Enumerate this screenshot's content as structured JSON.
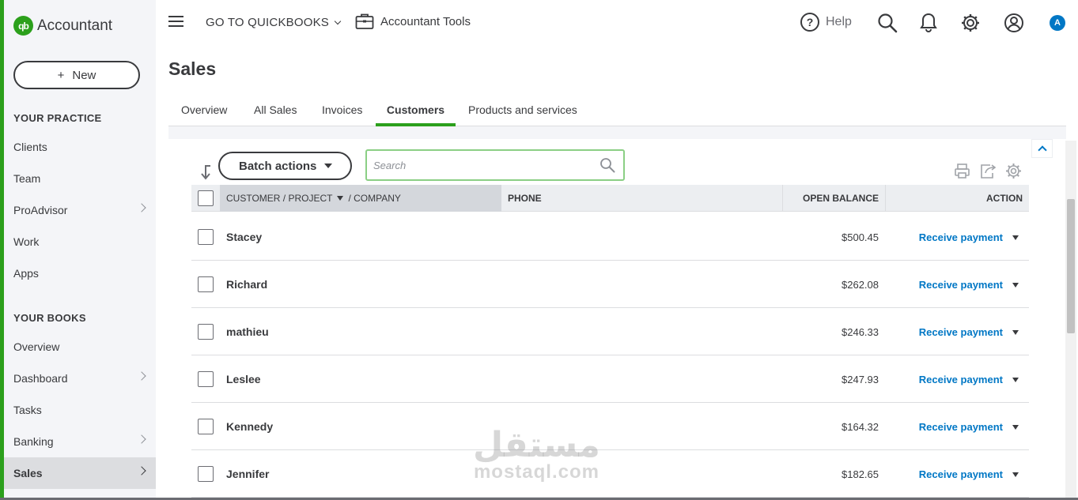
{
  "app": {
    "brand": "Accountant",
    "logo_text": "qb",
    "accent_color": "#2ca01c",
    "link_color": "#0077c5"
  },
  "sidebar": {
    "new_label": "New",
    "new_icon": "plus-icon",
    "practice_heading": "YOUR PRACTICE",
    "practice_items": [
      {
        "label": "Clients",
        "has_submenu": false
      },
      {
        "label": "Team",
        "has_submenu": false
      },
      {
        "label": "ProAdvisor",
        "has_submenu": true
      },
      {
        "label": "Work",
        "has_submenu": false
      },
      {
        "label": "Apps",
        "has_submenu": false
      }
    ],
    "books_heading": "YOUR BOOKS",
    "books_items": [
      {
        "label": "Overview",
        "has_submenu": false
      },
      {
        "label": "Dashboard",
        "has_submenu": true
      },
      {
        "label": "Tasks",
        "has_submenu": false
      },
      {
        "label": "Banking",
        "has_submenu": true
      },
      {
        "label": "Sales",
        "has_submenu": true,
        "active": true
      }
    ]
  },
  "topbar": {
    "goto_label": "GO TO QUICKBOOKS",
    "accountant_tools_label": "Accountant Tools",
    "help_label": "Help",
    "avatar_initial": "A"
  },
  "page": {
    "title": "Sales",
    "tabs": [
      {
        "label": "Overview",
        "active": false
      },
      {
        "label": "All Sales",
        "active": false
      },
      {
        "label": "Invoices",
        "active": false
      },
      {
        "label": "Customers",
        "active": true
      },
      {
        "label": "Products and services",
        "active": false
      }
    ]
  },
  "toolbar": {
    "batch_actions_label": "Batch actions",
    "search_placeholder": "Search",
    "search_value": ""
  },
  "table": {
    "columns": {
      "customer": "CUSTOMER / PROJECT",
      "company": "/ COMPANY",
      "phone": "PHONE",
      "open_balance": "OPEN BALANCE",
      "action": "ACTION"
    },
    "rows": [
      {
        "name": "Stacey",
        "phone": "",
        "balance": "$500.45",
        "action": "Receive payment"
      },
      {
        "name": "Richard",
        "phone": "",
        "balance": "$262.08",
        "action": "Receive payment"
      },
      {
        "name": "mathieu",
        "phone": "",
        "balance": "$246.33",
        "action": "Receive payment"
      },
      {
        "name": "Leslee",
        "phone": "",
        "balance": "$247.93",
        "action": "Receive payment"
      },
      {
        "name": "Kennedy",
        "phone": "",
        "balance": "$164.32",
        "action": "Receive payment"
      },
      {
        "name": "Jennifer",
        "phone": "",
        "balance": "$182.65",
        "action": "Receive payment"
      }
    ]
  },
  "watermark": {
    "arabic": "مستقل",
    "latin": "mostaql.com"
  }
}
